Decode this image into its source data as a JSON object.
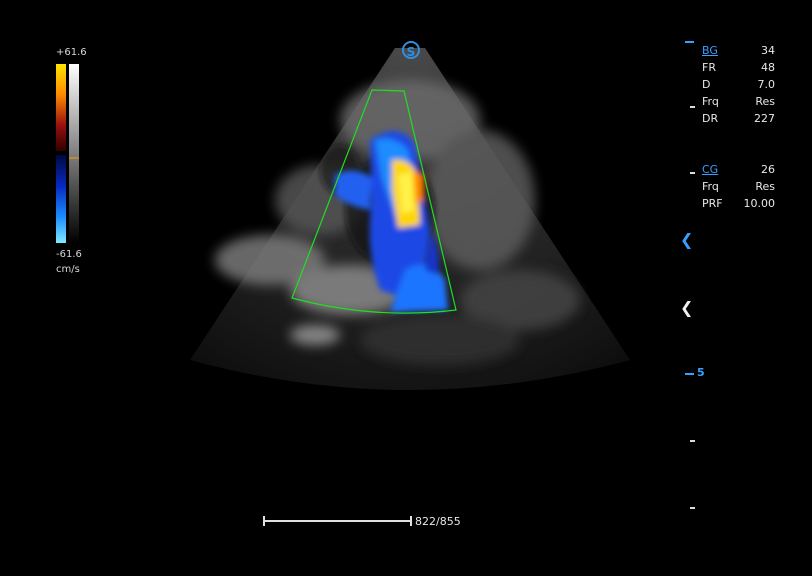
{
  "colorbar": {
    "max_label": "+61.6",
    "min_label": "-61.6",
    "unit": "cm/s"
  },
  "s_icon": {
    "letter": "S",
    "icon": "sector-s-icon"
  },
  "bmode_params": [
    {
      "key": "BG",
      "value": "34",
      "link": true
    },
    {
      "key": "FR",
      "value": "48",
      "link": false
    },
    {
      "key": "D",
      "value": "7.0",
      "link": false
    },
    {
      "key": "Frq",
      "value": "Res",
      "link": false
    },
    {
      "key": "DR",
      "value": "227",
      "link": false
    }
  ],
  "color_params": [
    {
      "key": "CG",
      "value": "26",
      "link": true
    },
    {
      "key": "Frq",
      "value": "Res",
      "link": false
    },
    {
      "key": "PRF",
      "value": "10.00",
      "link": false
    }
  ],
  "depth_scale": {
    "label_5": "5"
  },
  "cine": {
    "frame_text": "822/855"
  },
  "colors": {
    "accent": "#3aa0ff",
    "roi": "#22dd22"
  }
}
